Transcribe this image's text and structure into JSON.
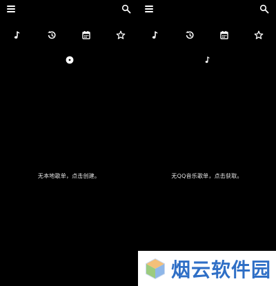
{
  "colors": {
    "background": "#000000",
    "icon": "#ffffff",
    "text": "#e6e6e6",
    "watermark_text": "#2f6fc6"
  },
  "panels": [
    {
      "topbar": {
        "menu_icon": "menu-icon",
        "search_icon": "search-icon"
      },
      "tabs": [
        {
          "icon": "music-note-icon"
        },
        {
          "icon": "history-icon"
        },
        {
          "icon": "calendar-icon"
        },
        {
          "icon": "star-icon"
        }
      ],
      "indicator_icon": "disc-icon",
      "empty_message": "无本地歌单，点击创建。"
    },
    {
      "topbar": {
        "menu_icon": "menu-icon",
        "search_icon": "search-icon"
      },
      "tabs": [
        {
          "icon": "music-note-icon"
        },
        {
          "icon": "history-icon"
        },
        {
          "icon": "calendar-icon"
        },
        {
          "icon": "star-icon"
        }
      ],
      "indicator_icon": "music-note-icon",
      "empty_message": "无QQ音乐歌单，点击获取。"
    }
  ],
  "watermark": {
    "text": "烟云软件园"
  }
}
